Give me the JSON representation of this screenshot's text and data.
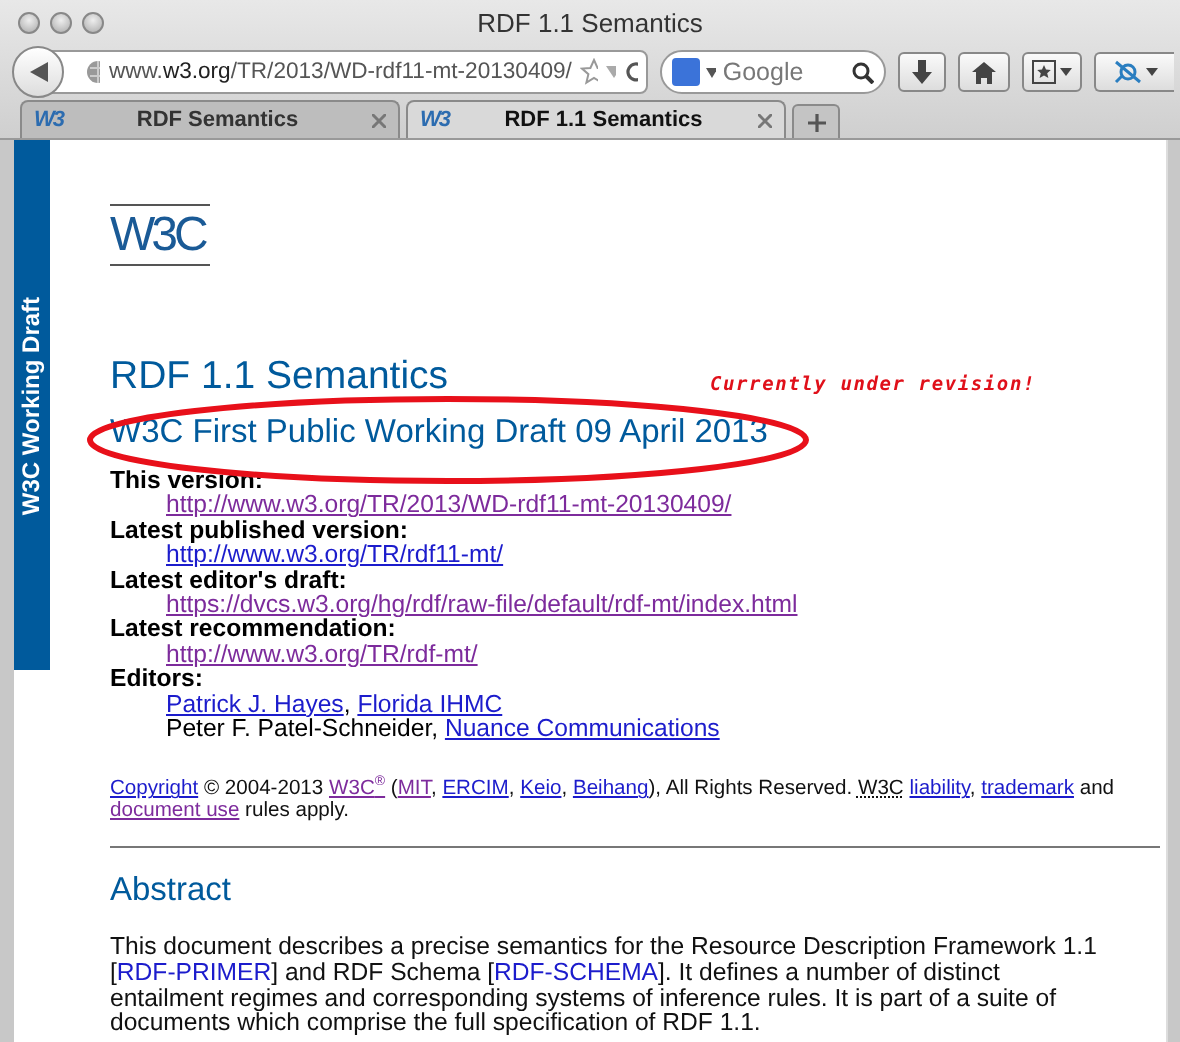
{
  "window": {
    "title": "RDF 1.1 Semantics"
  },
  "toolbar": {
    "url": "www.**w3.org**/TR/2013/WD-rdf11-mt-20130409/",
    "search": {
      "placeholder": "Google"
    }
  },
  "tabs": [
    {
      "icon": "W3",
      "label": "RDF Semantics",
      "selected": false
    },
    {
      "icon": "W3",
      "label": "RDF 1.1 Semantics",
      "selected": true
    }
  ],
  "page": {
    "sidebar_label": "W3C Working Draft",
    "logo": "W3C",
    "title": "RDF 1.1 Semantics",
    "subtitle": "W3C First Public Working Draft 09 April 2013",
    "annotation": "Currently under revision!",
    "metadata": [
      {
        "label": "This version:",
        "lines": [
          [
            {
              "text": "http://www.w3.org/TR/2013/WD-rdf11-mt-20130409/",
              "kind": "link",
              "visited": true
            }
          ]
        ]
      },
      {
        "label": "Latest published version:",
        "lines": [
          [
            {
              "text": "http://www.w3.org/TR/rdf11-mt/",
              "kind": "link",
              "visited": false
            }
          ]
        ]
      },
      {
        "label": "Latest editor's draft:",
        "lines": [
          [
            {
              "text": "https://dvcs.w3.org/hg/rdf/raw-file/default/rdf-mt/index.html",
              "kind": "link",
              "visited": true
            }
          ]
        ]
      },
      {
        "label": "Latest recommendation:",
        "lines": [
          [
            {
              "text": "http://www.w3.org/TR/rdf-mt/",
              "kind": "link",
              "visited": true
            }
          ]
        ]
      },
      {
        "label": "Editors:",
        "lines": [
          [
            {
              "text": "Patrick J. Hayes",
              "kind": "link",
              "visited": false
            },
            {
              "text": ", ",
              "kind": "plain"
            },
            {
              "text": "Florida IHMC",
              "kind": "link",
              "visited": false
            }
          ],
          [
            {
              "text": "Peter F. Patel-Schneider, ",
              "kind": "plain"
            },
            {
              "text": "Nuance Communications",
              "kind": "link",
              "visited": false
            }
          ]
        ]
      }
    ],
    "copyright": [
      {
        "text": "Copyright",
        "kind": "link",
        "visited": false
      },
      {
        "text": " © 2004-2013 ",
        "kind": "plain"
      },
      {
        "text": "W3C$^{®}$",
        "kind": "link",
        "visited": true
      },
      {
        "text": " (",
        "kind": "plain"
      },
      {
        "text": "MIT",
        "kind": "link",
        "visited": true
      },
      {
        "text": ", ",
        "kind": "plain"
      },
      {
        "text": "ERCIM",
        "kind": "link",
        "visited": false
      },
      {
        "text": ", ",
        "kind": "plain"
      },
      {
        "text": "Keio",
        "kind": "link",
        "visited": false
      },
      {
        "text": ", ",
        "kind": "plain"
      },
      {
        "text": "Beihang",
        "kind": "link",
        "visited": false
      },
      {
        "text": "), All Rights Reserved. ",
        "kind": "plain"
      },
      {
        "text": "W3C",
        "kind": "abbr"
      },
      {
        "text": "liability",
        "kind": "link",
        "visited": false
      },
      {
        "text": ", ",
        "kind": "plain"
      },
      {
        "text": "trademark",
        "kind": "link",
        "visited": false
      },
      {
        "text": " and ",
        "kind": "plain"
      },
      {
        "text": "document use",
        "kind": "link",
        "visited": true
      },
      {
        "text": " rules apply.",
        "kind": "plain"
      }
    ],
    "abstract_heading": "Abstract",
    "abstract": [
      {
        "text": "This document describes a precise semantics for the Resource Description Framework 1.1 [",
        "kind": "plain"
      },
      {
        "text": "RDF-PRIMER",
        "kind": "ref"
      },
      {
        "text": "] and RDF Schema [",
        "kind": "plain"
      },
      {
        "text": "RDF-SCHEMA",
        "kind": "ref"
      },
      {
        "text": "]. It defines a number of distinct entailment regimes and corresponding systems of inference rules. It is part of a suite of documents which comprise the full specification of RDF 1.1.",
        "kind": "plain"
      }
    ]
  }
}
